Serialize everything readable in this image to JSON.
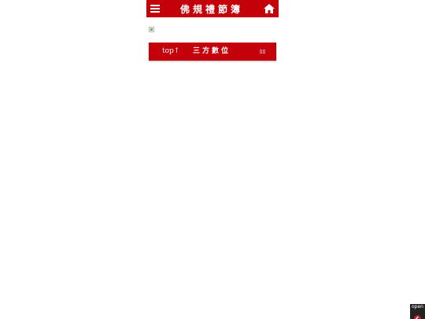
{
  "header": {
    "title": "佛規禮節簿",
    "menu_icon": "hamburger-menu-icon",
    "home_icon": "home-icon",
    "background_color": "#c4000b"
  },
  "nav": {
    "top_label": "top↑",
    "section_title": "三方數位",
    "right_icon": "language-toggle-icon"
  },
  "widget": {
    "open_label": "open",
    "icon": "chevron-left-icon"
  }
}
